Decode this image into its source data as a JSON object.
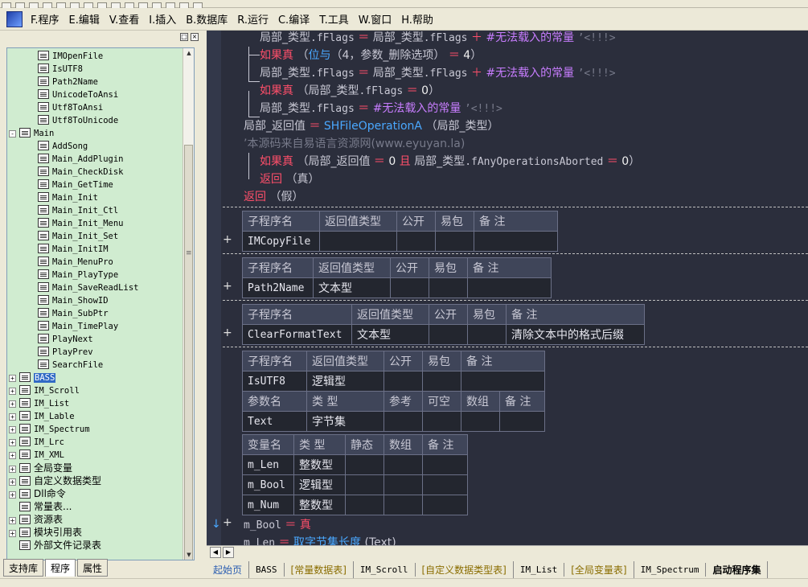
{
  "menu": [
    "F.程序",
    "E.编辑",
    "V.查看",
    "I.插入",
    "B.数据库",
    "R.运行",
    "C.编译",
    "T.工具",
    "W.窗口",
    "H.帮助"
  ],
  "tree": {
    "items": [
      {
        "label": "IMOpenFile",
        "level": 2
      },
      {
        "label": "IsUTF8",
        "level": 2
      },
      {
        "label": "Path2Name",
        "level": 2
      },
      {
        "label": "UnicodeToAnsi",
        "level": 2
      },
      {
        "label": "Utf8ToAnsi",
        "level": 2
      },
      {
        "label": "Utf8ToUnicode",
        "level": 2
      },
      {
        "label": "Main",
        "level": 1,
        "expander": "-"
      },
      {
        "label": "AddSong",
        "level": 2
      },
      {
        "label": "Main_AddPlugin",
        "level": 2
      },
      {
        "label": "Main_CheckDisk",
        "level": 2
      },
      {
        "label": "Main_GetTime",
        "level": 2
      },
      {
        "label": "Main_Init",
        "level": 2
      },
      {
        "label": "Main_Init_Ctl",
        "level": 2
      },
      {
        "label": "Main_Init_Menu",
        "level": 2
      },
      {
        "label": "Main_Init_Set",
        "level": 2
      },
      {
        "label": "Main_InitIM",
        "level": 2
      },
      {
        "label": "Main_MenuPro",
        "level": 2
      },
      {
        "label": "Main_PlayType",
        "level": 2
      },
      {
        "label": "Main_SaveReadList",
        "level": 2
      },
      {
        "label": "Main_ShowID",
        "level": 2
      },
      {
        "label": "Main_SubPtr",
        "level": 2
      },
      {
        "label": "Main_TimePlay",
        "level": 2
      },
      {
        "label": "PlayNext",
        "level": 2
      },
      {
        "label": "PlayPrev",
        "level": 2
      },
      {
        "label": "SearchFile",
        "level": 2
      },
      {
        "label": "BASS",
        "level": 1,
        "expander": "+",
        "selected": true
      },
      {
        "label": "IM_Scroll",
        "level": 1,
        "expander": "+"
      },
      {
        "label": "IM_List",
        "level": 1,
        "expander": "+"
      },
      {
        "label": "IM_Lable",
        "level": 1,
        "expander": "+"
      },
      {
        "label": "IM_Spectrum",
        "level": 1,
        "expander": "+"
      },
      {
        "label": "IM_Lrc",
        "level": 1,
        "expander": "+"
      },
      {
        "label": "IM_XML",
        "level": 1,
        "expander": "+"
      },
      {
        "label": "全局变量",
        "level": 1,
        "expander": "+",
        "cn": true
      },
      {
        "label": "自定义数据类型",
        "level": 1,
        "expander": "+",
        "cn": true
      },
      {
        "label": "Dll命令",
        "level": 1,
        "expander": "+",
        "cn": true
      },
      {
        "label": "常量表...",
        "level": 1,
        "cn": true
      },
      {
        "label": "资源表",
        "level": 1,
        "expander": "+",
        "cn": true
      },
      {
        "label": "模块引用表",
        "level": 1,
        "expander": "+",
        "cn": true
      },
      {
        "label": "外部文件记录表",
        "level": 1,
        "cn": true
      }
    ]
  },
  "bottom_tabs": [
    "支持库",
    "程序",
    "属性"
  ],
  "code": {
    "l1": {
      "a": "局部_类型",
      "b": ".fFlags",
      "c": "＝",
      "d": "局部_类型",
      "e": ".fFlags",
      "f": "＋",
      "g": "#无法载入的常量",
      "h": "’<!!!>"
    },
    "l2": {
      "kw": "如果真",
      "fn": "位与",
      "args": "（4，参数_删除选项）",
      "op": "＝",
      "num": "4",
      "close": "）"
    },
    "l3": {
      "a": "局部_类型",
      "b": ".fFlags",
      "c": "＝",
      "d": "局部_类型",
      "e": ".fFlags",
      "f": "＋",
      "g": "#无法载入的常量",
      "h": "’<!!!>"
    },
    "l4": {
      "kw": "如果真",
      "open": "（局部_类型",
      "b": ".fFlags",
      "op": "＝",
      "num": "0",
      "close": "）"
    },
    "l5": {
      "a": "局部_类型",
      "b": ".fFlags",
      "c": "＝",
      "g": "#无法载入的常量",
      "h": "’<!!!>"
    },
    "l6": {
      "a": "局部_返回值",
      "c": "＝",
      "fn": "SHFileOperationA",
      "arg": "（局部_类型）"
    },
    "l7": {
      "cm": "’本源码来自易语言资源网(www.eyuyan.la)"
    },
    "l8": {
      "kw": "如果真",
      "open": "（局部_返回值",
      "op": "＝",
      "num": "0",
      "and": "且",
      "b": "局部_类型",
      "c": ".fAnyOperationsAborted",
      "op2": "＝",
      "num2": "0",
      "close": "）"
    },
    "l9": {
      "kw": "返回",
      "arg": "（真）"
    },
    "l10": {
      "kw": "返回",
      "arg": "（假）"
    },
    "l11": {
      "a": "m_Bool",
      "op": "＝",
      "kw": "真"
    },
    "l12": {
      "a": "m_Len",
      "op": "＝",
      "fn": "取字节集长度",
      "arg": "(Text)"
    }
  },
  "tables": {
    "t1": {
      "headers": [
        "子程序名",
        "返回值类型",
        "公开",
        "易包",
        "备 注"
      ],
      "row": [
        "IMCopyFile",
        "",
        "",
        "",
        ""
      ]
    },
    "t2": {
      "headers": [
        "子程序名",
        "返回值类型",
        "公开",
        "易包",
        "备 注"
      ],
      "row": [
        "Path2Name",
        "文本型",
        "",
        "",
        ""
      ]
    },
    "t3": {
      "headers": [
        "子程序名",
        "返回值类型",
        "公开",
        "易包",
        "备 注"
      ],
      "row": [
        "ClearFormatText",
        "文本型",
        "",
        "",
        "清除文本中的格式后缀"
      ]
    },
    "t4": {
      "headers": [
        "子程序名",
        "返回值类型",
        "公开",
        "易包",
        "备 注"
      ],
      "row": [
        "IsUTF8",
        "逻辑型",
        "",
        "",
        ""
      ],
      "pheaders": [
        "参数名",
        "类 型",
        "参考",
        "可空",
        "数组",
        "备 注"
      ],
      "prow": [
        "Text",
        "字节集",
        "",
        "",
        "",
        ""
      ]
    },
    "t5": {
      "headers": [
        "变量名",
        "类 型",
        "静态",
        "数组",
        "备 注"
      ],
      "rows": [
        [
          "m_Len",
          "整数型",
          "",
          "",
          ""
        ],
        [
          "m_Bool",
          "逻辑型",
          "",
          "",
          ""
        ],
        [
          "m_Num",
          "整数型",
          "",
          "",
          ""
        ]
      ]
    }
  },
  "doc_tabs": [
    "起始页",
    "BASS",
    "[常量数据表]",
    "IM_Scroll",
    "[自定义数据类型表]",
    "IM_List",
    "[全局变量表]",
    "IM_Spectrum",
    "启动程序集"
  ],
  "colors": {
    "editor_bg": "#2b2e3c",
    "keyword": "#ff4f6a",
    "function": "#4aa8ff",
    "constant": "#c87dff",
    "comment": "#777a8a",
    "tree_bg": "#d0ecd0"
  }
}
